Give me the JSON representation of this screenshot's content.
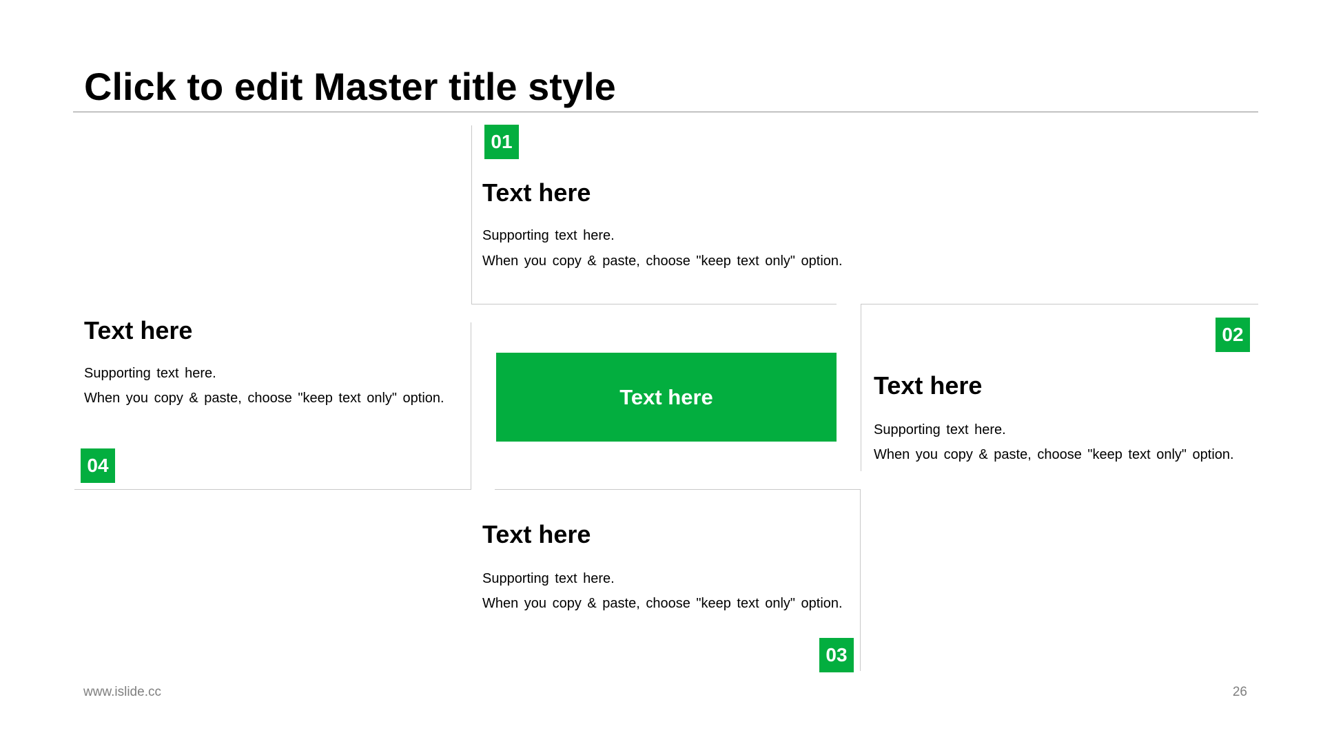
{
  "title": "Click to edit Master title style",
  "accent_color": "#03ae3f",
  "center_label": "Text here",
  "blocks": [
    {
      "number": "01",
      "heading": "Text here",
      "line1": "Supporting text here.",
      "line2": "When you copy & paste, choose \"keep text only\" option."
    },
    {
      "number": "02",
      "heading": "Text here",
      "line1": "Supporting text here.",
      "line2": "When you copy & paste, choose \"keep text only\" option."
    },
    {
      "number": "03",
      "heading": "Text here",
      "line1": "Supporting text here.",
      "line2": "When you copy & paste, choose \"keep text only\" option."
    },
    {
      "number": "04",
      "heading": "Text here",
      "line1": "Supporting text here.",
      "line2": "When you copy & paste, choose \"keep text only\" option."
    }
  ],
  "footer": {
    "url": "www.islide.cc",
    "page": "26"
  }
}
